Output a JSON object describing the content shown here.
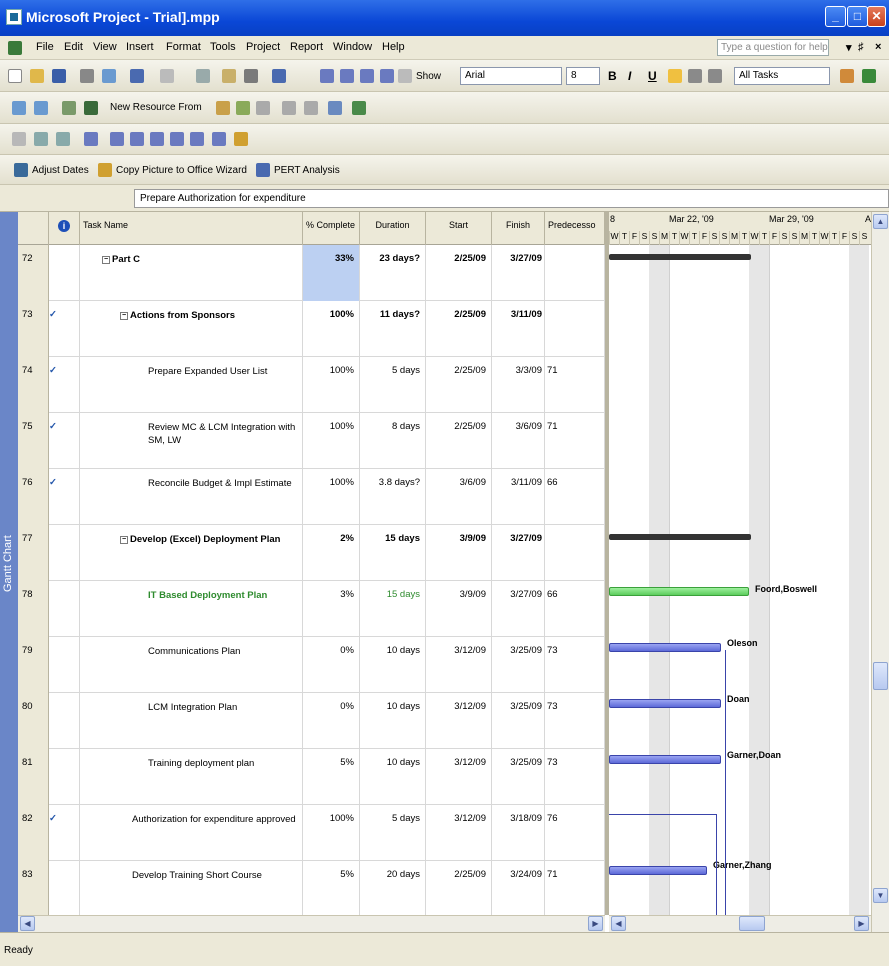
{
  "window": {
    "title": "Microsoft Project - Trial].mpp"
  },
  "menu": {
    "items": [
      "File",
      "Edit",
      "View",
      "Insert",
      "Format",
      "Tools",
      "Project",
      "Report",
      "Window",
      "Help"
    ],
    "help_placeholder": "Type a question for help"
  },
  "toolbar1": {
    "show_label": "Show",
    "font": "Arial",
    "size": "8",
    "filter": "All Tasks"
  },
  "toolbar2": {
    "new_resource_from": "New Resource From"
  },
  "toolbar4": {
    "adjust_dates": "Adjust Dates",
    "copy_picture": "Copy Picture to Office Wizard",
    "pert_analysis": "PERT Analysis"
  },
  "entry_bar": {
    "value": "Prepare Authorization for expenditure"
  },
  "view_bar": {
    "label": "Gantt Chart"
  },
  "columns": {
    "indicators": "i",
    "task_name": "Task Name",
    "pct": "% Complete",
    "duration": "Duration",
    "start": "Start",
    "finish": "Finish",
    "pred": "Predecesso"
  },
  "timescale": {
    "week0": "8",
    "week1": "Mar 22, '09",
    "week2": "Mar 29, '09",
    "week3": "A",
    "days": [
      "W",
      "T",
      "F",
      "S",
      "S",
      "M",
      "T",
      "W",
      "T",
      "F",
      "S",
      "S",
      "M",
      "T",
      "W",
      "T",
      "F",
      "S",
      "S",
      "M",
      "T",
      "W",
      "T",
      "F",
      "S",
      "S"
    ]
  },
  "tasks": [
    {
      "id": "72",
      "check": "",
      "name": "Part C",
      "pct": "33%",
      "duration": "23 days?",
      "start": "2/25/09",
      "finish": "3/27/09",
      "pred": ""
    },
    {
      "id": "73",
      "check": "✓",
      "name": "Actions from Sponsors",
      "pct": "100%",
      "duration": "11 days?",
      "start": "2/25/09",
      "finish": "3/11/09",
      "pred": ""
    },
    {
      "id": "74",
      "check": "✓",
      "name": "Prepare Expanded User List",
      "pct": "100%",
      "duration": "5 days",
      "start": "2/25/09",
      "finish": "3/3/09",
      "pred": "71"
    },
    {
      "id": "75",
      "check": "✓",
      "name": "Review MC & LCM Integration with SM, LW",
      "pct": "100%",
      "duration": "8 days",
      "start": "2/25/09",
      "finish": "3/6/09",
      "pred": "71"
    },
    {
      "id": "76",
      "check": "✓",
      "name": "Reconcile Budget & Impl Estimate",
      "pct": "100%",
      "duration": "3.8 days?",
      "start": "3/6/09",
      "finish": "3/11/09",
      "pred": "66"
    },
    {
      "id": "77",
      "check": "",
      "name": "Develop (Excel) Deployment Plan",
      "pct": "2%",
      "duration": "15 days",
      "start": "3/9/09",
      "finish": "3/27/09",
      "pred": ""
    },
    {
      "id": "78",
      "check": "",
      "name": "IT Based Deployment Plan",
      "pct": "3%",
      "duration": "15 days",
      "start": "3/9/09",
      "finish": "3/27/09",
      "pred": "66"
    },
    {
      "id": "79",
      "check": "",
      "name": "Communications Plan",
      "pct": "0%",
      "duration": "10 days",
      "start": "3/12/09",
      "finish": "3/25/09",
      "pred": "73"
    },
    {
      "id": "80",
      "check": "",
      "name": "LCM Integration Plan",
      "pct": "0%",
      "duration": "10 days",
      "start": "3/12/09",
      "finish": "3/25/09",
      "pred": "73"
    },
    {
      "id": "81",
      "check": "",
      "name": "Training deployment plan",
      "pct": "5%",
      "duration": "10 days",
      "start": "3/12/09",
      "finish": "3/25/09",
      "pred": "73"
    },
    {
      "id": "82",
      "check": "✓",
      "name": "Authorization for expenditure approved",
      "pct": "100%",
      "duration": "5 days",
      "start": "3/12/09",
      "finish": "3/18/09",
      "pred": "76"
    },
    {
      "id": "83",
      "check": "",
      "name": "Develop Training Short Course",
      "pct": "5%",
      "duration": "20 days",
      "start": "2/25/09",
      "finish": "3/24/09",
      "pred": "71"
    }
  ],
  "gantt_labels": {
    "r78": "Foord,Boswell",
    "r79": "Oleson",
    "r80": "Doan",
    "r81": "Garner,Doan",
    "r83": "Garner,Zhang"
  },
  "status": {
    "text": "Ready"
  }
}
